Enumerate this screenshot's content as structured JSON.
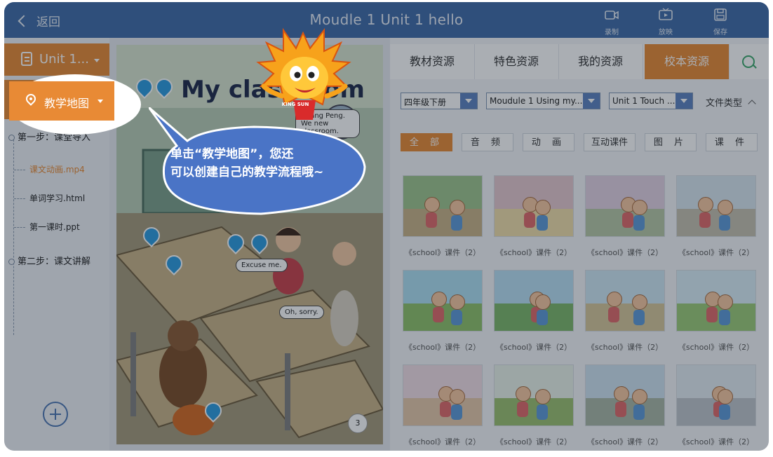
{
  "header": {
    "back_label": "返回",
    "title": "Moudle 1 Unit  1 hello",
    "tools": [
      {
        "icon": "record-icon",
        "label": "录制"
      },
      {
        "icon": "play-screen-icon",
        "label": "放映"
      },
      {
        "icon": "save-icon",
        "label": "保存"
      }
    ]
  },
  "sidebar": {
    "unit_selector": "Unit 1...",
    "map_selector": "教学地图",
    "steps": [
      {
        "label": "第一步：课堂导入",
        "items": [
          "课文动画.mp4",
          "单词学习.html",
          "第一课时.ppt"
        ]
      },
      {
        "label": "第二步：课文讲解",
        "items": []
      }
    ],
    "active_item": "课文动画.mp4"
  },
  "book": {
    "title": "My classroom",
    "bubbles": [
      "Zhang Peng. We new classroom.",
      "Excuse me.",
      "Oh, sorry."
    ],
    "page_number": "3"
  },
  "resources": {
    "tabs": [
      "教材资源",
      "特色资源",
      "我的资源",
      "校本资源"
    ],
    "active_tab": "校本资源",
    "filters": {
      "grade": "四年级下册",
      "module": "Moudule 1 Using my...",
      "unit": "Unit 1 Touch ...",
      "file_type_label": "文件类型"
    },
    "categories": [
      "全 部",
      "音 频",
      "动 画",
      "互动课件",
      "图 片",
      "课 件"
    ],
    "active_category": "全 部",
    "thumb_caption": "《school》课件（2）",
    "thumb_count": 12
  },
  "guide": {
    "text_line1": "单击“教学地图”，您还",
    "text_line2": "可以创建自己的教学流程哦~",
    "mascot_badge": "KING SUN"
  },
  "colors": {
    "header": "#3f6ba8",
    "accent": "#e88a35",
    "tip_bubble": "#4a74c6"
  }
}
